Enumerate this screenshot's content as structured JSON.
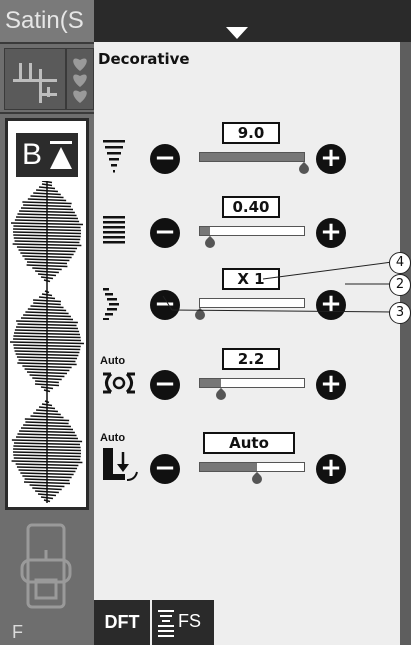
{
  "window": {
    "title": "Satin(S"
  },
  "left_rail": {
    "preset_label": "B",
    "foot_letter": "F"
  },
  "panel": {
    "title": "Decorative",
    "rows": [
      {
        "name": "width",
        "value": "9.0",
        "level": 1.0
      },
      {
        "name": "density",
        "value": "0.40",
        "level": 0.1
      },
      {
        "name": "elongation",
        "value": "X 1",
        "level": 0.0
      },
      {
        "name": "auto-tension",
        "icon_label": "Auto",
        "value": "2.2",
        "level": 0.2
      },
      {
        "name": "auto-presser-foot",
        "icon_label": "Auto",
        "value": "Auto",
        "level": 0.55
      }
    ],
    "minus_symbol": "−",
    "plus_symbol": "+"
  },
  "tabs": {
    "dft": "DFT",
    "fs": "FS"
  },
  "callouts": {
    "c2": "2",
    "c3": "3",
    "c4": "4"
  },
  "colors": {
    "dark": "#2a2a2a",
    "rail": "#6e6e6e",
    "panel": "#eeeeee",
    "fill": "#777777"
  }
}
